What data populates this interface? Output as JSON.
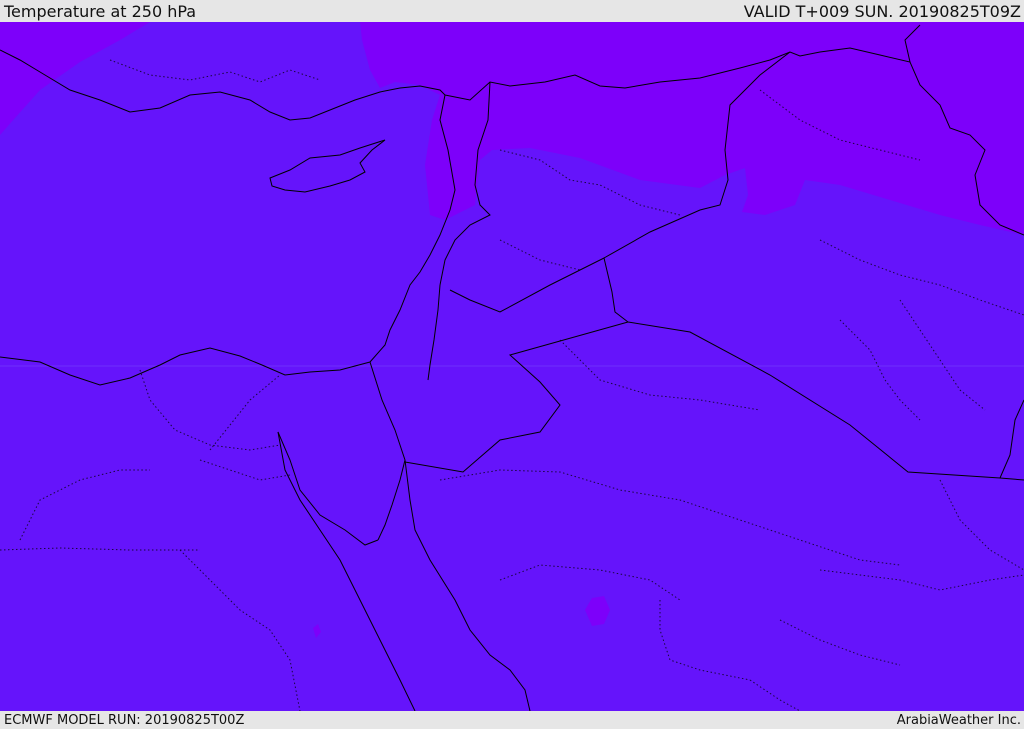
{
  "header": {
    "title": "Temperature at 250 hPa",
    "valid": "VALID T+009 SUN. 20190825T09Z"
  },
  "footer": {
    "model_run": "ECMWF MODEL RUN: 20190825T00Z",
    "credit": "ArabiaWeather Inc."
  },
  "colors": {
    "base_field": "#6514fb",
    "cold_field": "#7d00fa",
    "border": "#000000"
  }
}
